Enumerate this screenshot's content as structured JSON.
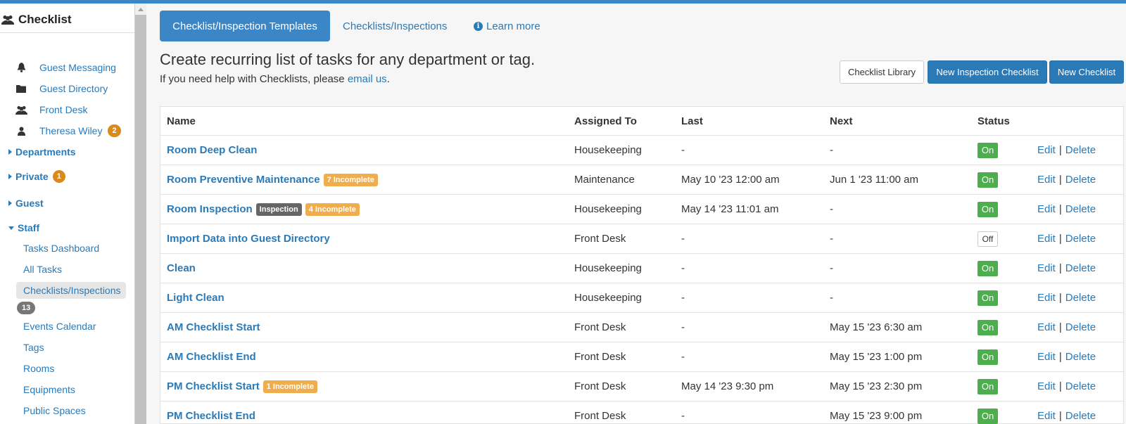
{
  "sidebar": {
    "title": "Checklist",
    "title_icon": "users-icon",
    "items": [
      {
        "label": "Guest Messaging",
        "icon": "bell-icon"
      },
      {
        "label": "Guest Directory",
        "icon": "folder-icon"
      },
      {
        "label": "Front Desk",
        "icon": "users-icon"
      },
      {
        "label": "Theresa Wiley",
        "icon": "user-icon",
        "badge": "2"
      }
    ],
    "sections": [
      {
        "label": "Departments"
      },
      {
        "label": "Private",
        "badge": "1"
      },
      {
        "label": "Guest"
      },
      {
        "label": "Staff"
      }
    ],
    "staff_items": [
      {
        "label": "Tasks Dashboard"
      },
      {
        "label": "All Tasks"
      },
      {
        "label": "Checklists/Inspections",
        "badge": "13",
        "active": true
      },
      {
        "label": "Events Calendar"
      },
      {
        "label": "Tags"
      },
      {
        "label": "Rooms"
      },
      {
        "label": "Equipments"
      },
      {
        "label": "Public Spaces"
      }
    ]
  },
  "tabs": {
    "active": "Checklist/Inspection Templates",
    "second": "Checklists/Inspections",
    "learn_more": "Learn more"
  },
  "header": {
    "headline": "Create recurring list of tasks for any department or tag.",
    "help_prefix": "If you need help with Checklists, please ",
    "help_link": "email us",
    "help_suffix": "."
  },
  "buttons": {
    "library": "Checklist Library",
    "new_inspection": "New Inspection Checklist",
    "new_checklist": "New Checklist"
  },
  "table": {
    "columns": [
      "Name",
      "Assigned To",
      "Last",
      "Next",
      "Status"
    ],
    "edit_label": "Edit",
    "delete_label": "Delete",
    "separator": "|",
    "rows": [
      {
        "name": "Room Deep Clean",
        "tags": [],
        "assigned": "Housekeeping",
        "last": "-",
        "next": "-",
        "status": "On"
      },
      {
        "name": "Room Preventive Maintenance",
        "tags": [
          {
            "text": "7 Incomplete",
            "color": "#f0ad4e"
          }
        ],
        "assigned": "Maintenance",
        "last": "May 10 '23 12:00 am",
        "next": "Jun 1 '23 11:00 am",
        "status": "On"
      },
      {
        "name": "Room Inspection",
        "tags": [
          {
            "text": "Inspection",
            "color": "#666666"
          },
          {
            "text": "4 Incomplete",
            "color": "#f0ad4e"
          }
        ],
        "assigned": "Housekeeping",
        "last": "May 14 '23 11:01 am",
        "next": "-",
        "status": "On"
      },
      {
        "name": "Import Data into Guest Directory",
        "tags": [],
        "assigned": "Front Desk",
        "last": "-",
        "next": "-",
        "status": "Off"
      },
      {
        "name": "Clean",
        "tags": [],
        "assigned": "Housekeeping",
        "last": "-",
        "next": "-",
        "status": "On"
      },
      {
        "name": "Light Clean",
        "tags": [],
        "assigned": "Housekeeping",
        "last": "-",
        "next": "-",
        "status": "On"
      },
      {
        "name": "AM Checklist Start",
        "tags": [],
        "assigned": "Front Desk",
        "last": "-",
        "next": "May 15 '23 6:30 am",
        "status": "On"
      },
      {
        "name": "AM Checklist End",
        "tags": [],
        "assigned": "Front Desk",
        "last": "-",
        "next": "May 15 '23 1:00 pm",
        "status": "On"
      },
      {
        "name": "PM Checklist Start",
        "tags": [
          {
            "text": "1 Incomplete",
            "color": "#f0ad4e"
          }
        ],
        "assigned": "Front Desk",
        "last": "May 14 '23 9:30 pm",
        "next": "May 15 '23 2:30 pm",
        "status": "On"
      },
      {
        "name": "PM Checklist End",
        "tags": [],
        "assigned": "Front Desk",
        "last": "-",
        "next": "May 15 '23 9:00 pm",
        "status": "On"
      }
    ]
  },
  "colors": {
    "accent": "#3b86c6",
    "link": "#2a7ab8",
    "status_on": "#4cae4c",
    "tag_orange": "#f0ad4e",
    "tag_dark": "#666666",
    "badge_orange": "#d98a19"
  }
}
